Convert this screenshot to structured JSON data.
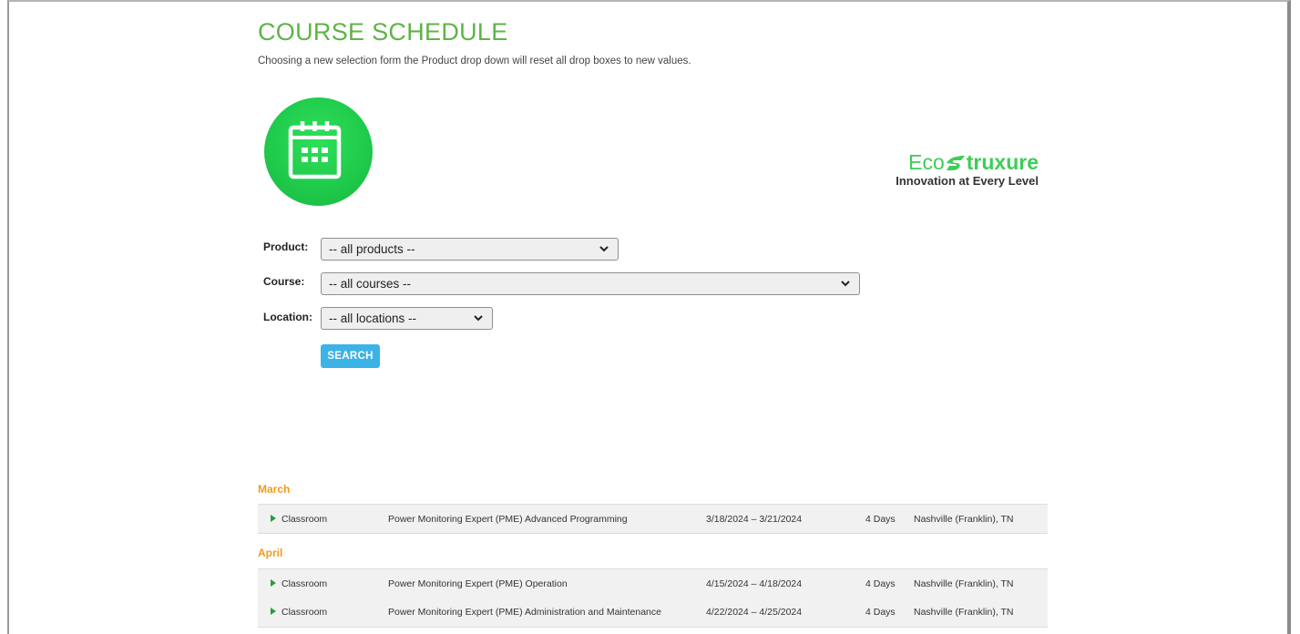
{
  "page": {
    "title": "COURSE SCHEDULE",
    "subtitle": "Choosing a new selection form the Product drop down will reset all drop boxes to new values."
  },
  "brand": {
    "name_prefix": "Eco",
    "name_suffix": "truxure",
    "tagline": "Innovation at Every Level",
    "color": "#3dcd58"
  },
  "icons": {
    "calendar": "calendar-icon",
    "dropdown": "chevron-down-icon",
    "expand": "play-triangle-icon"
  },
  "form": {
    "product": {
      "label": "Product:",
      "value": "-- all products --"
    },
    "course": {
      "label": "Course:",
      "value": "-- all courses --"
    },
    "location": {
      "label": "Location:",
      "value": "-- all locations --"
    },
    "search_label": "SEARCH"
  },
  "schedule": [
    {
      "month": "March",
      "rows": [
        {
          "type": "Classroom",
          "title": "Power Monitoring Expert (PME) Advanced Programming",
          "dates": "3/18/2024 – 3/21/2024",
          "days": "4 Days",
          "location": "Nashville (Franklin), TN"
        }
      ]
    },
    {
      "month": "April",
      "rows": [
        {
          "type": "Classroom",
          "title": "Power Monitoring Expert (PME) Operation",
          "dates": "4/15/2024 – 4/18/2024",
          "days": "4 Days",
          "location": "Nashville (Franklin), TN"
        },
        {
          "type": "Classroom",
          "title": "Power Monitoring Expert (PME) Administration and Maintenance",
          "dates": "4/22/2024 – 4/25/2024",
          "days": "4 Days",
          "location": "Nashville (Franklin), TN"
        }
      ]
    }
  ],
  "colors": {
    "title": "#5fb347",
    "month": "#f39a1e",
    "button": "#3cb3e6",
    "calendar_circle": "#1fc94a"
  }
}
